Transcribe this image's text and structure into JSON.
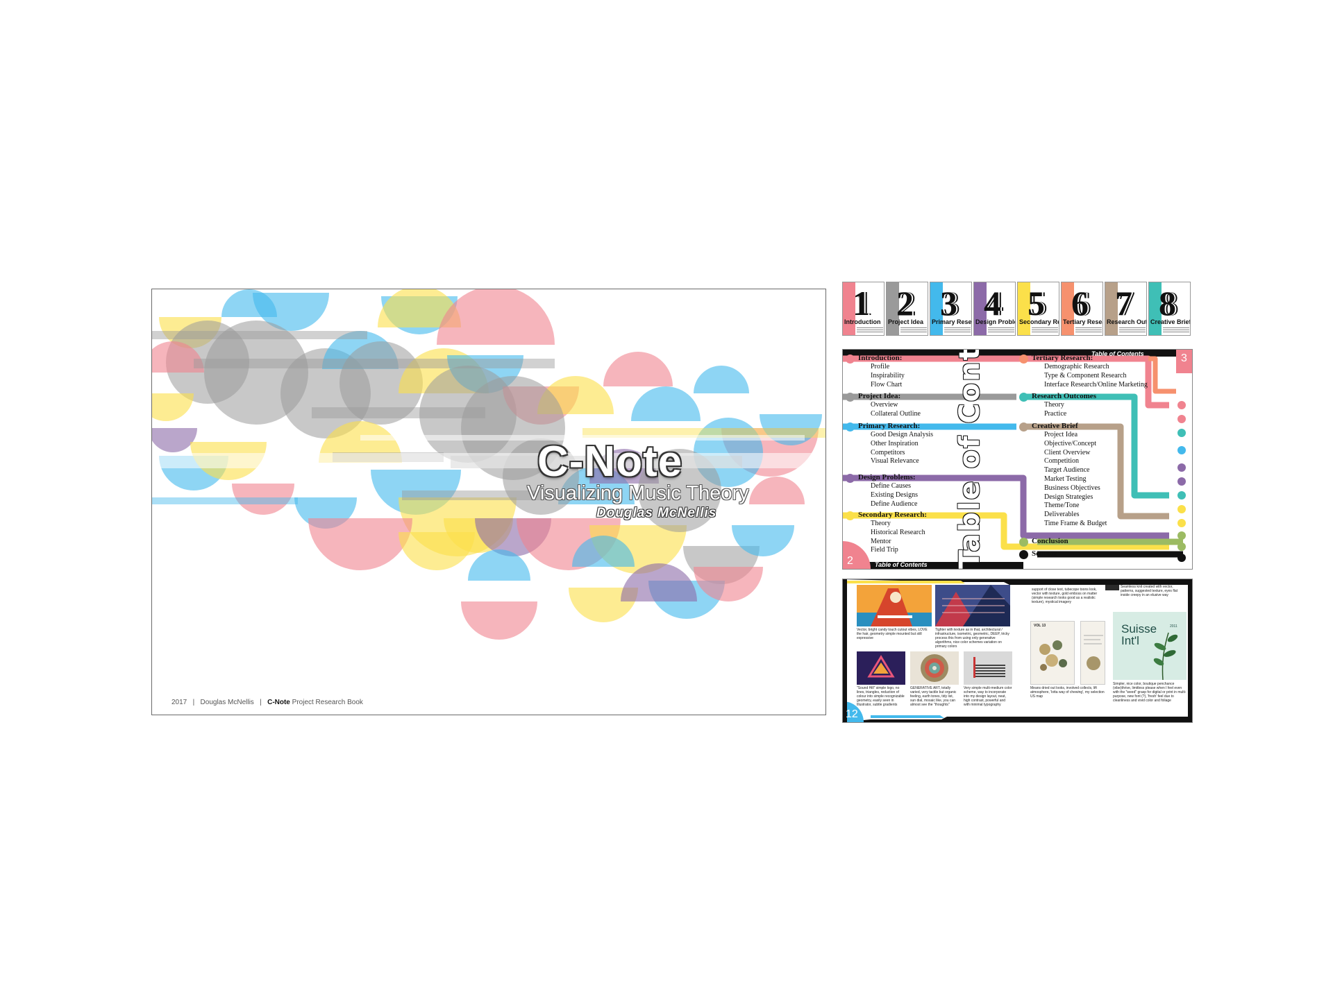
{
  "cover": {
    "title": "C-Note",
    "subtitle": "Visualizing Music Theory",
    "author": "Douglas McNellis",
    "footer_year": "2017",
    "footer_sep": "|",
    "footer_author": "Douglas McNellis",
    "footer_brand": "C-Note",
    "footer_book": "Project Research Book"
  },
  "colors": {
    "pink": "#f0838f",
    "gray": "#9a9a9a",
    "blue": "#43b9ec",
    "purple": "#8c6aa8",
    "yellow": "#fbe04a",
    "orange": "#f6916e",
    "tan": "#b7a089",
    "teal": "#3fbfb6",
    "green": "#9cbb63"
  },
  "chapters": [
    {
      "num": "1",
      "label": "Introduction",
      "color": "#f0838f"
    },
    {
      "num": "2",
      "label": "Project Idea",
      "color": "#9a9a9a"
    },
    {
      "num": "3",
      "label": "Primary Research",
      "color": "#43b9ec"
    },
    {
      "num": "4",
      "label": "Design Problems",
      "color": "#8c6aa8"
    },
    {
      "num": "5",
      "label": "Secondary Research",
      "color": "#fbe04a"
    },
    {
      "num": "6",
      "label": "Tertiary Research",
      "color": "#f6916e"
    },
    {
      "num": "7",
      "label": "Research Outcomes",
      "color": "#b7a089"
    },
    {
      "num": "8",
      "label": "Creative Brief",
      "color": "#3fbfb6"
    }
  ],
  "toc": {
    "vertical_title": "Table of Contents",
    "header_label": "Table of Contents",
    "footer_label": "Table of Contents",
    "page_left": "2",
    "page_right": "3",
    "left_sections": [
      {
        "title": "Introduction:",
        "color": "#f0838f",
        "items": [
          "Profile",
          "Inspirability",
          "Flow Chart"
        ]
      },
      {
        "title": "Project Idea:",
        "color": "#9a9a9a",
        "items": [
          "Overview",
          "Collateral Outline"
        ]
      },
      {
        "title": "Primary Research:",
        "color": "#43b9ec",
        "items": [
          "Good Design Analysis",
          "Other Inspiration",
          "Competitors",
          "Visual Relevance"
        ]
      },
      {
        "title": "Design Problems:",
        "color": "#8c6aa8",
        "items": [
          "Define Causes",
          "Existing Designs",
          "Define Audience"
        ]
      },
      {
        "title": "Secondary Research:",
        "color": "#fbe04a",
        "items": [
          "Theory",
          "Historical Research",
          "Mentor",
          "Field Trip"
        ]
      }
    ],
    "right_sections": [
      {
        "title": "Tertiary Research:",
        "color": "#f6916e",
        "items": [
          "Demographic Research",
          "Type & Component Research",
          "Interface Research/Online Marketing"
        ]
      },
      {
        "title": "Research Outcomes",
        "color": "#3fbfb6",
        "items": [
          "Theory",
          "Practice"
        ]
      },
      {
        "title": "Creative Brief",
        "color": "#b7a089",
        "items": [
          "Project Idea",
          "Objective/Concept",
          "Client Overview",
          "Competition",
          "Target Audience",
          "Market Testing",
          "Business Objectives",
          "Design Strategies",
          "Theme/Tone",
          "Deliverables",
          "Time Frame & Budget"
        ]
      },
      {
        "title": "Conclusion",
        "color": "#9cbb63",
        "items": []
      },
      {
        "title": "Sources",
        "color": "#111111",
        "items": []
      }
    ]
  },
  "research": {
    "page_left": "12",
    "captions": [
      "Vector, bright candy touch cutout vibes, LOVE the hair, geometry simple mounted but still expressive",
      "Tighter with texture as in that, architectural / infrastructure, isometric, geometric, DEEP, tricky process this from using only generative algorithms, nice color schemes variation on primary colors",
      "\"Sound Hill\" simple logo, no lines, triangles, reduction of colour into simple recognizable geometry, easily seen in Illustrator, subtle gradients",
      "GENERATIVE ART, totally varied, very tactile but organic feeling, earth tones, tidy list, sun dial, mosaic like, you can almost see the \"thoughts\"",
      "Very simple multi-medium color scheme, way to incorporate into my design layout, neat, high contrast, powerful and with minimal typography",
      "support of close text, tubecope toons look, vector with texture, gold emboss on matter (simple research looks good as a realistic texture), mystical imagery",
      "Seamless knit created with vector, patterns, suggested texture, eyes flat inside creepy in an elusive way",
      "Means dried out looks, involved collects, lift atmosphere, 'lotta way of chewing', my selection US map",
      "Simpler, nice color, boutique penchance (vibe)thrive, limitless please when I feel even with the \"weed\" grasp for digital or print in multi-purpose, new font (?), 'fresh' feel due to cleanliness and vivid color and foliage"
    ],
    "poster_title_1": "Suisse",
    "poster_title_2": "Int'l",
    "poster_year": "2011",
    "small_poster_label": "VOL 13"
  }
}
